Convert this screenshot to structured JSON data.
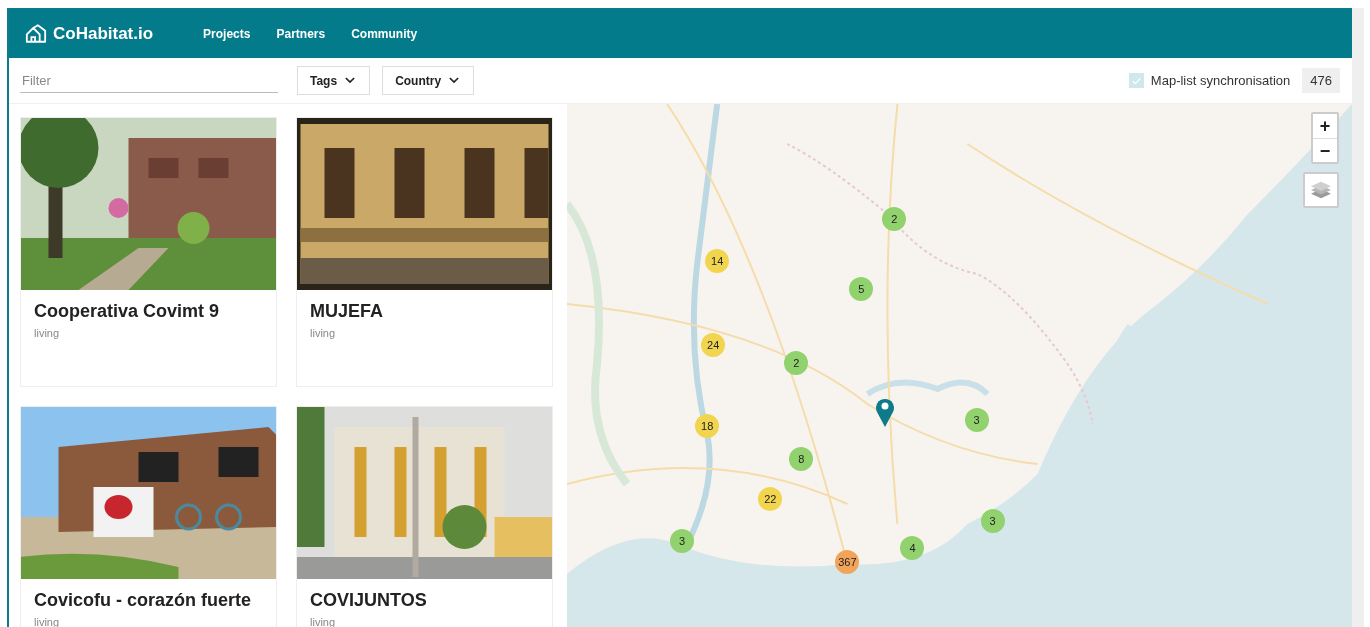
{
  "header": {
    "brand": "CoHabitat.io",
    "nav": [
      {
        "label": "Projects"
      },
      {
        "label": "Partners"
      },
      {
        "label": "Community"
      }
    ]
  },
  "toolbar": {
    "filter": {
      "placeholder": "Filter"
    },
    "dropdowns": [
      {
        "label": "Tags"
      },
      {
        "label": "Country"
      }
    ],
    "sync": {
      "label": "Map-list synchronisation",
      "checked": true
    },
    "count": "476"
  },
  "projects": [
    {
      "title": "Cooperativa Covimt 9",
      "tag": "living",
      "kind": "picture"
    },
    {
      "title": "MUJEFA",
      "tag": "living",
      "kind": "picture"
    },
    {
      "title": "Covicofu - corazón fuerte",
      "tag": "living",
      "kind": "picture"
    },
    {
      "title": "COVIJUNTOS",
      "tag": "living",
      "kind": "picture"
    }
  ],
  "map": {
    "kind": "picture",
    "zoom_controls": [
      {
        "label": "+"
      },
      {
        "label": "−"
      }
    ],
    "clusters": [
      {
        "count": "2",
        "color": "#91d26e"
      },
      {
        "count": "14",
        "color": "#f1d54f"
      },
      {
        "count": "5",
        "color": "#91d26e"
      },
      {
        "count": "24",
        "color": "#f1d54f"
      },
      {
        "count": "2",
        "color": "#91d26e"
      },
      {
        "count": "18",
        "color": "#f1d54f"
      },
      {
        "count": "3",
        "color": "#91d26e"
      },
      {
        "count": "8",
        "color": "#91d26e"
      },
      {
        "count": "22",
        "color": "#f1d54f"
      },
      {
        "count": "3",
        "color": "#91d26e"
      },
      {
        "count": "3",
        "color": "#91d26e"
      },
      {
        "count": "4",
        "color": "#91d26e"
      },
      {
        "count": "367",
        "color": "#f2a45a"
      }
    ]
  }
}
